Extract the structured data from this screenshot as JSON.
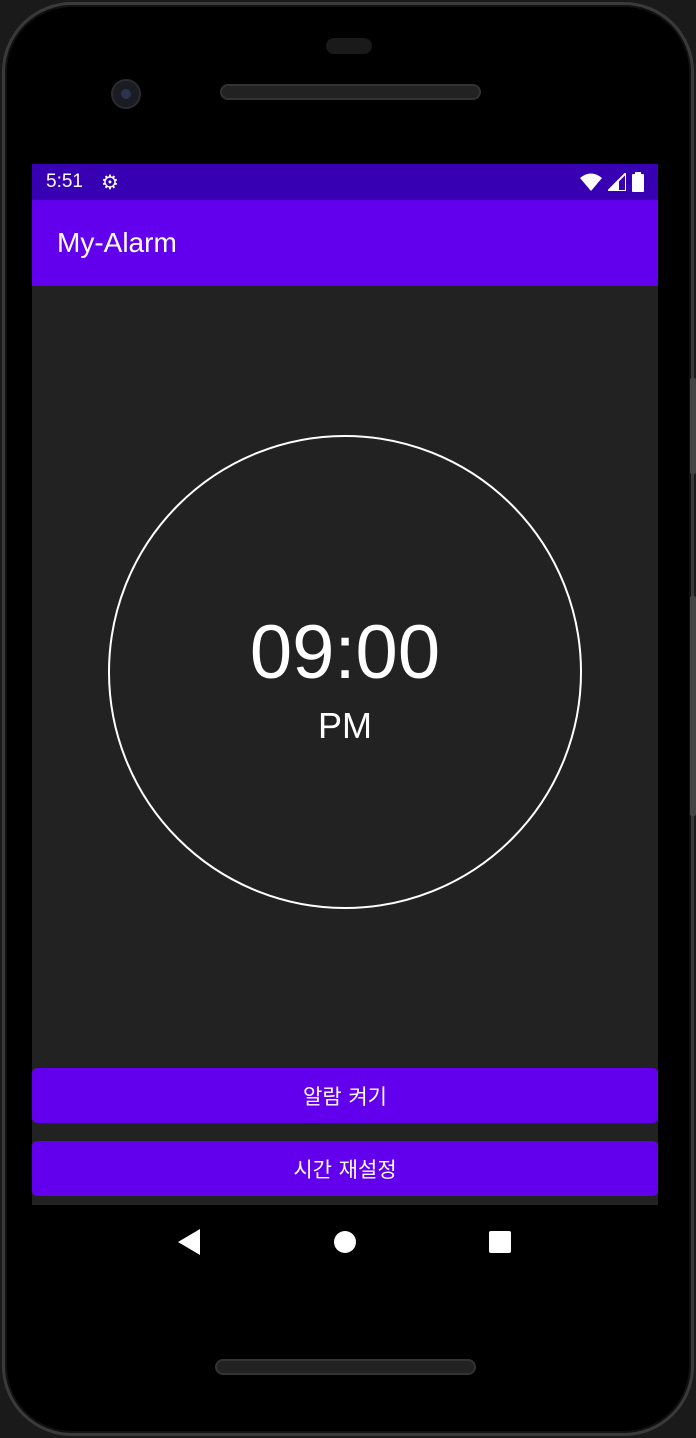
{
  "status": {
    "time": "5:51"
  },
  "app": {
    "title": "My-Alarm"
  },
  "alarm": {
    "time": "09:00",
    "ampm": "PM"
  },
  "buttons": {
    "toggle": "알람 켜기",
    "reset": "시간 재설정"
  },
  "colors": {
    "primary": "#6200ee",
    "status": "#3700b3",
    "bg": "#222222"
  }
}
